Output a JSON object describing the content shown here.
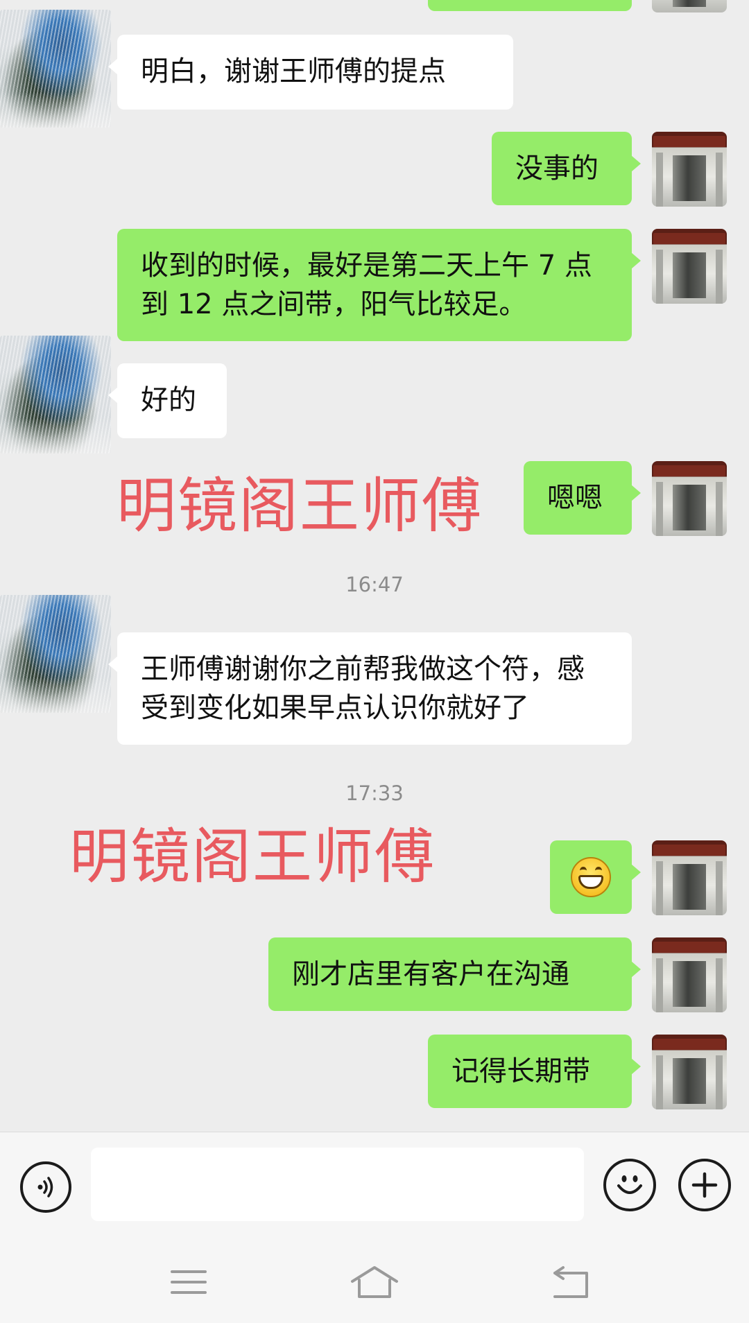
{
  "messages": [
    {
      "side": "right",
      "text": ""
    },
    {
      "side": "left",
      "text": "明白，谢谢王师傅的提点"
    },
    {
      "side": "right",
      "text": "没事的"
    },
    {
      "side": "right",
      "text": "收到的时候，最好是第二天上午 7 点到 12 点之间带，阳气比较足。"
    },
    {
      "side": "left",
      "text": "好的"
    },
    {
      "side": "right",
      "text": "嗯嗯"
    },
    {
      "side": "left",
      "text": "王师傅谢谢你之前帮我做这个符，感受到变化如果早点认识你就好了"
    },
    {
      "side": "right",
      "text": "",
      "emoji": "grinning-face"
    },
    {
      "side": "right",
      "text": "刚才店里有客户在沟通"
    },
    {
      "side": "right",
      "text": "记得长期带"
    }
  ],
  "timestamps": [
    "16:47",
    "17:33"
  ],
  "watermarks": [
    "明镜阁王师傅",
    "明镜阁王师傅"
  ],
  "input": {
    "placeholder": ""
  },
  "colors": {
    "self_bubble": "#95ec69",
    "other_bubble": "#ffffff",
    "background": "#ededed",
    "watermark": "#e85a5f"
  }
}
